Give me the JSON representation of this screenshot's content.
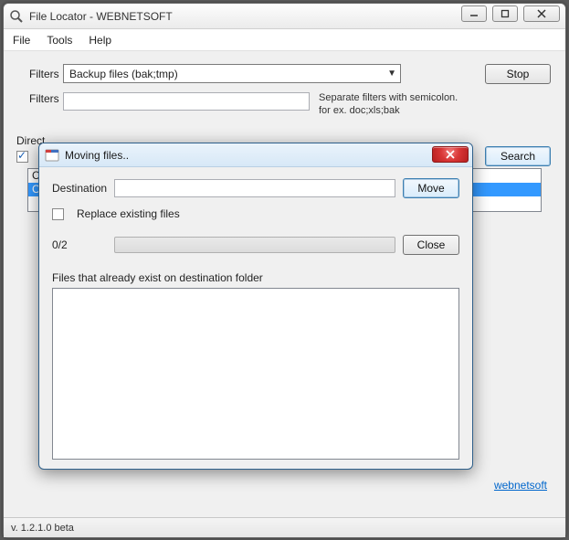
{
  "main": {
    "title": "File Locator - WEBNETSOFT",
    "menu": {
      "file": "File",
      "tools": "Tools",
      "help": "Help"
    },
    "filters_label": "Filters",
    "filters_combo_value": "Backup files (bak;tmp)",
    "filters_text_label": "Filters",
    "filters_text_value": "",
    "filters_hint_line1": "Separate filters with semicolon.",
    "filters_hint_line2": "for ex. doc;xls;bak",
    "directory_label": "Direct",
    "recursive_checked": true,
    "list": {
      "row0": "C:\\d",
      "row1": "C:\\S"
    },
    "stop_btn": "Stop",
    "search_btn": "Search",
    "footer_link": "webnetsoft",
    "version": "v. 1.2.1.0 beta"
  },
  "dialog": {
    "title": "Moving files..",
    "destination_label": "Destination",
    "destination_value": "",
    "move_btn": "Move",
    "replace_label": "Replace existing files",
    "replace_checked": false,
    "progress_text": "0/2",
    "close_btn": "Close",
    "exist_label": "Files that already exist on destination folder"
  }
}
